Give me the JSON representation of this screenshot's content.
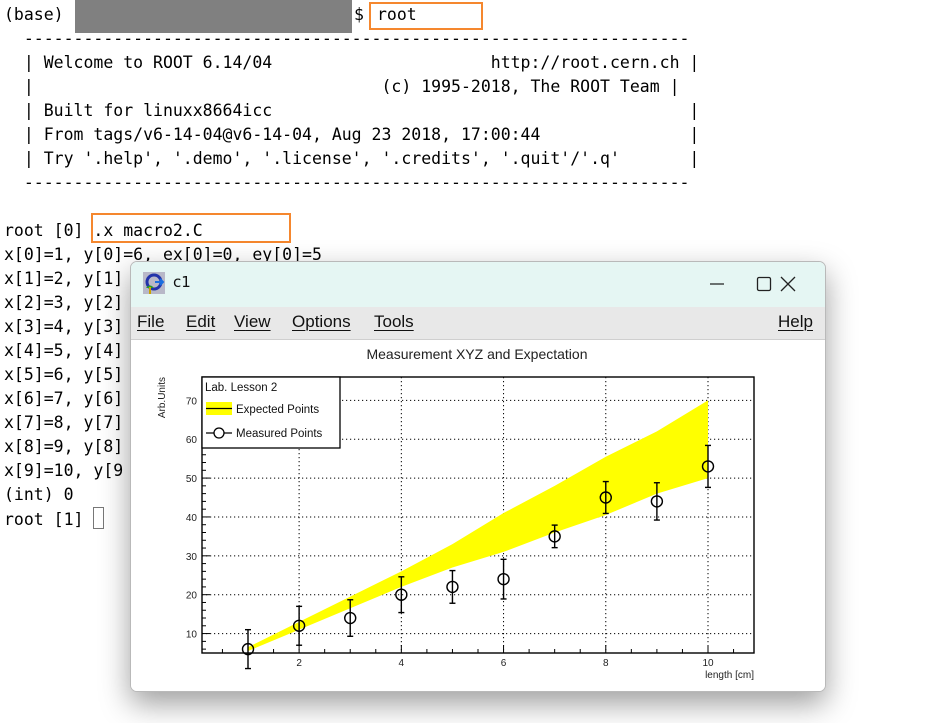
{
  "terminal": {
    "prompt_prefix": "(base)",
    "prompt_suffix": "$",
    "command1": "root",
    "banner": [
      "  -------------------------------------------------------------------",
      "  | Welcome to ROOT 6.14/04                      http://root.cern.ch |",
      "  |                                   (c) 1995-2018, The ROOT Team |",
      "  | Built for linuxx8664icc                                          |",
      "  | From tags/v6-14-04@v6-14-04, Aug 23 2018, 17:00:44               |",
      "  | Try '.help', '.demo', '.license', '.credits', '.quit'/'.q'       |",
      "  -------------------------------------------------------------------"
    ],
    "prompt2": "root [0]",
    "command2": ".x macro2.C",
    "output_lines": [
      "x[0]=1, y[0]=6, ex[0]=0, ey[0]=5",
      "x[1]=2, y[1]",
      "x[2]=3, y[2]",
      "x[3]=4, y[3]",
      "x[4]=5, y[4]",
      "x[5]=6, y[5]",
      "x[6]=7, y[6]",
      "x[7]=8, y[7]",
      "x[8]=9, y[8]",
      "x[9]=10, y[9"
    ],
    "result": "(int) 0",
    "prompt3": "root [1]",
    "highlight_color": "#f5872e"
  },
  "window": {
    "title": "c1",
    "icon": "root-canvas-icon",
    "controls": {
      "minimize": "minimize-icon",
      "maximize": "maximize-icon",
      "close": "close-icon"
    },
    "menu": [
      {
        "key": "F",
        "rest": "ile"
      },
      {
        "key": "E",
        "rest": "dit"
      },
      {
        "key": "V",
        "rest": "iew"
      },
      {
        "key": "O",
        "rest": "ptions"
      },
      {
        "key": "T",
        "rest": "ools"
      }
    ],
    "help": {
      "key": "H",
      "rest": "elp"
    }
  },
  "chart_data": {
    "type": "scatter",
    "title": "Measurement XYZ and Expectation",
    "xlabel": "length [cm]",
    "ylabel": "Arb.Units",
    "xlim": [
      0.1,
      10.9
    ],
    "ylim": [
      5,
      76
    ],
    "xticks": [
      2,
      4,
      6,
      8,
      10
    ],
    "yticks": [
      10,
      20,
      30,
      40,
      50,
      60,
      70
    ],
    "grid": true,
    "legend": {
      "placement": "top-left",
      "header": "Lab. Lesson 2",
      "entries": [
        "Expected Points",
        "Measured Points"
      ]
    },
    "expected_band": {
      "name": "Expected Points",
      "color": "#ffff00",
      "x": [
        1,
        2,
        3,
        4,
        5,
        6,
        7,
        8,
        9,
        10
      ],
      "y": [
        6,
        12,
        18,
        24,
        30,
        36,
        42,
        48,
        54,
        60
      ],
      "err": [
        0.5,
        1.0,
        1.5,
        2.0,
        3.0,
        5.0,
        6.0,
        7.5,
        8.0,
        10.0
      ]
    },
    "measured": {
      "name": "Measured Points",
      "x": [
        1,
        2,
        3,
        4,
        5,
        6,
        7,
        8,
        9,
        10
      ],
      "y": [
        6,
        12,
        14,
        20,
        22,
        24,
        35,
        45,
        44,
        53
      ],
      "ex": [
        0,
        0,
        0,
        0,
        0,
        0,
        0,
        0,
        0,
        0
      ],
      "ey": [
        5,
        5,
        4.7,
        4.6,
        4.2,
        5.1,
        2.9,
        4.1,
        4.8,
        5.4
      ]
    }
  }
}
